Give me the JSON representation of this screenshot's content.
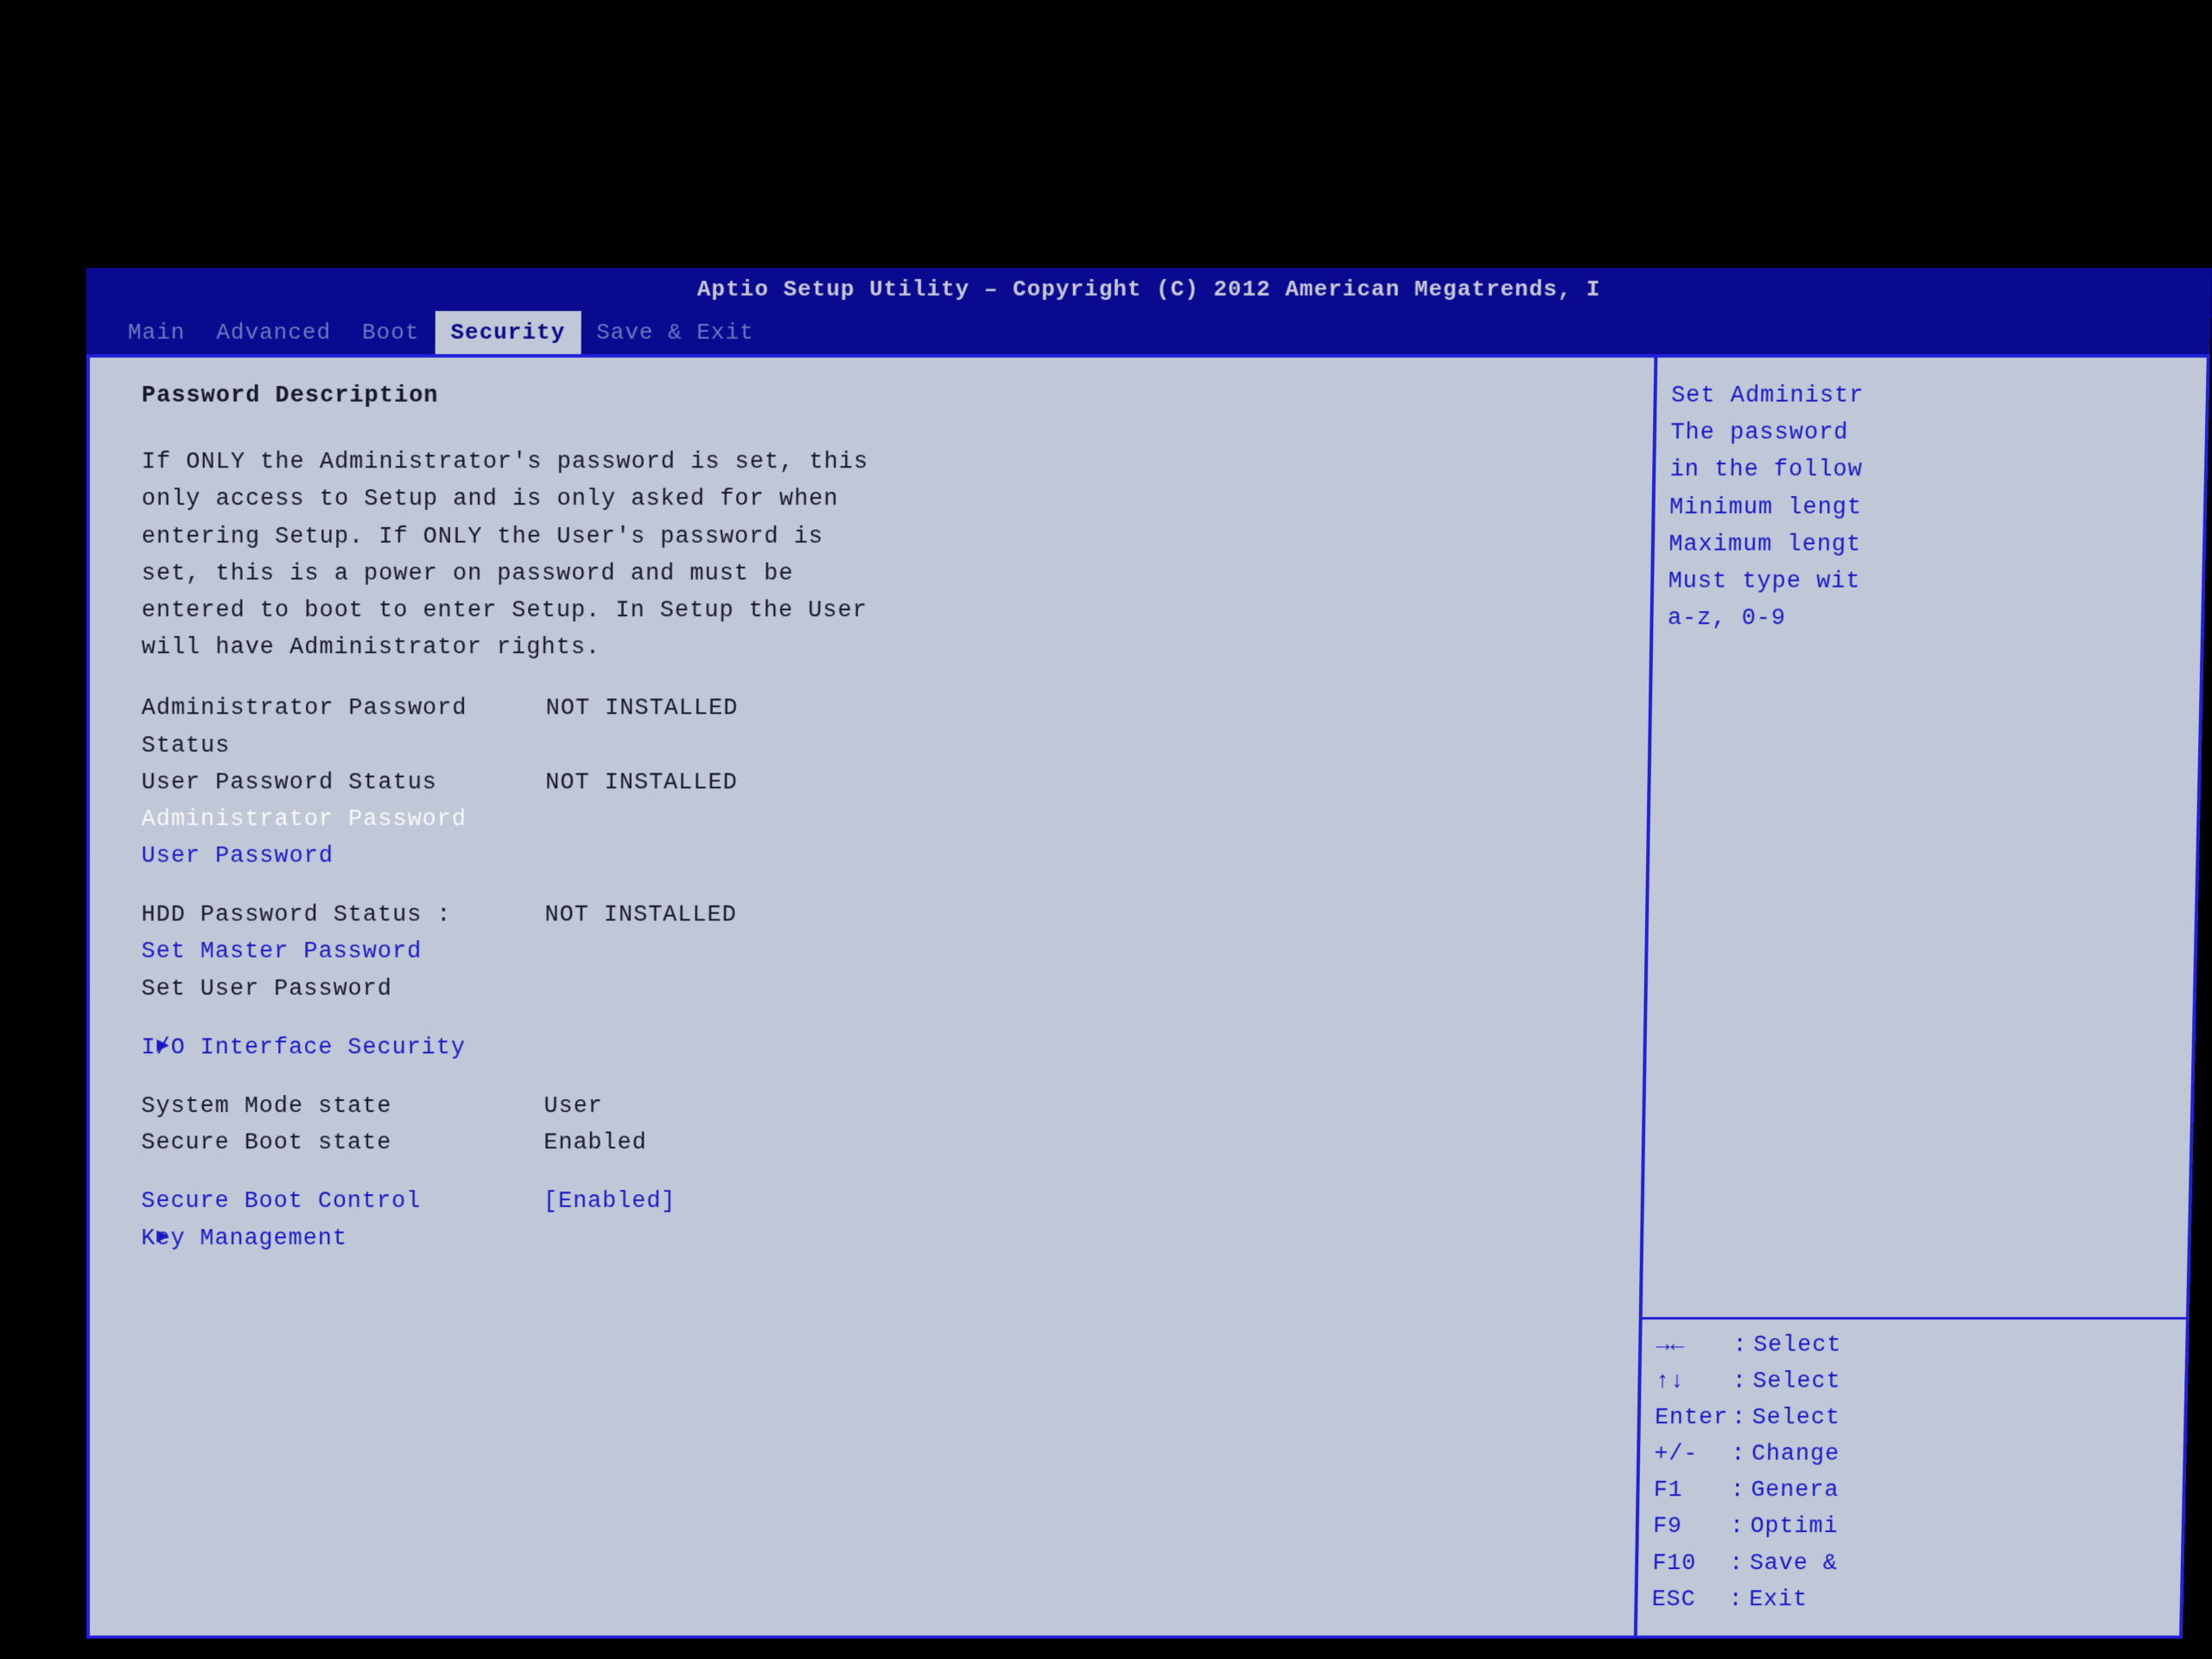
{
  "header": {
    "title": "Aptio Setup Utility – Copyright (C) 2012 American Megatrends, I"
  },
  "tabs": [
    "Main",
    "Advanced",
    "Boot",
    "Security",
    "Save & Exit"
  ],
  "active_tab": "Security",
  "main": {
    "section_title": "Password Description",
    "description": "If ONLY the Administrator's password is set, this only access to Setup and is only asked for when entering Setup. If ONLY the User's password is set, this is a power on password and must be entered to boot to enter Setup. In Setup the User will have Administrator rights.",
    "rows": {
      "admin_status": {
        "label": "Administrator Password Status",
        "value": "NOT INSTALLED"
      },
      "user_status": {
        "label": "User Password Status",
        "value": "NOT INSTALLED"
      },
      "admin_pwd": {
        "label": "Administrator Password"
      },
      "user_pwd": {
        "label": "User Password"
      },
      "hdd_status": {
        "label": "HDD Password Status   :",
        "value": "NOT INSTALLED"
      },
      "set_master": {
        "label": "Set Master Password"
      },
      "set_user": {
        "label": "Set User Password"
      },
      "io": {
        "label": "I/O Interface Security"
      },
      "sys_mode": {
        "label": "System Mode state",
        "value": "User"
      },
      "secboot_state": {
        "label": "Secure Boot state",
        "value": "Enabled"
      },
      "secboot_ctrl": {
        "label": "Secure Boot Control",
        "value": "[Enabled]"
      },
      "key_mgmt": {
        "label": "Key Management"
      }
    }
  },
  "help": {
    "lines": [
      "Set Administr",
      "The password ",
      "in the follow",
      "Minimum lengt",
      "Maximum lengt",
      "Must type wit",
      "a-z, 0-9"
    ],
    "keys": [
      {
        "k": "→←",
        "d": "Select"
      },
      {
        "k": "↑↓",
        "d": "Select"
      },
      {
        "k": "Enter",
        "d": "Select"
      },
      {
        "k": "+/-",
        "d": "Change"
      },
      {
        "k": "F1",
        "d": "Genera"
      },
      {
        "k": "F9",
        "d": "Optimi"
      },
      {
        "k": "F10",
        "d": "Save &"
      },
      {
        "k": "ESC",
        "d": "Exit"
      }
    ]
  }
}
